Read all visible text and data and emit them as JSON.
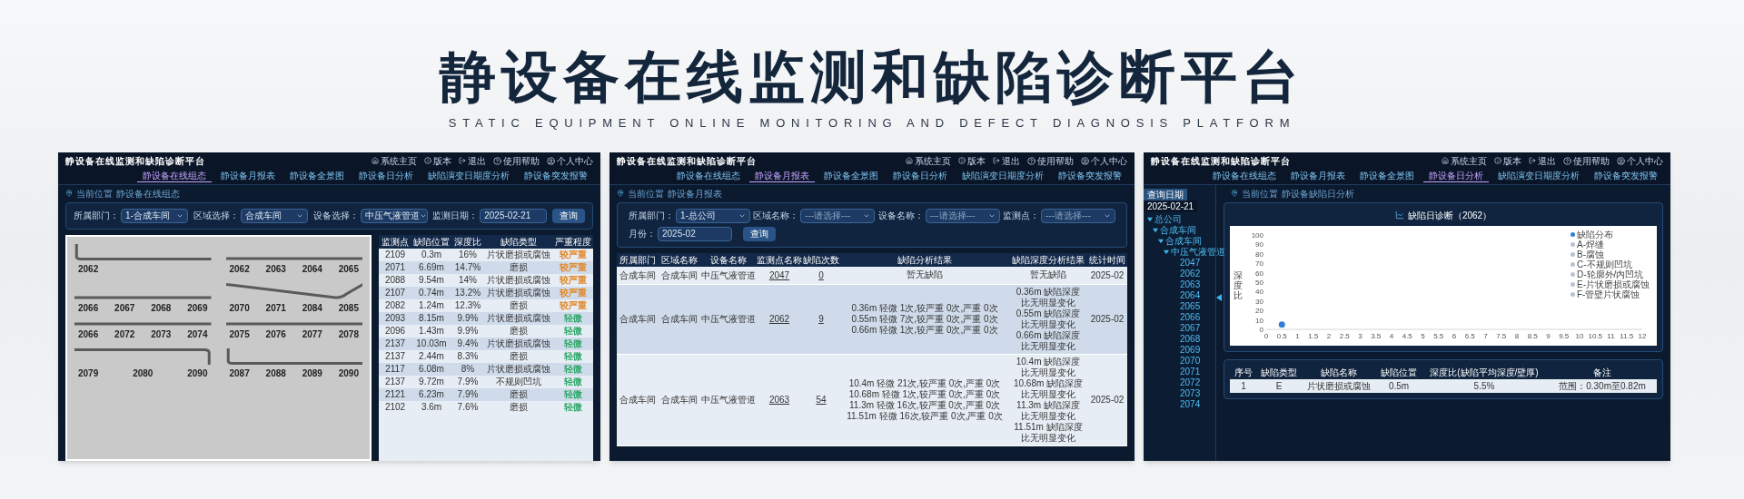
{
  "page": {
    "title": "静设备在线监测和缺陷诊断平台",
    "subtitle": "STATIC EQUIPMENT ONLINE MONITORING AND DEFECT DIAGNOSIS PLATFORM"
  },
  "screens": [
    {
      "kind": "layout",
      "header": {
        "title": "静设备在线监测和缺陷诊断平台",
        "top_links": [
          "系统主页",
          "版本",
          "退出"
        ],
        "help": "使用帮助",
        "user": "个人中心",
        "nav": [
          {
            "label": "静设备在线组态",
            "selected": true
          },
          {
            "label": "静设备月报表",
            "selected": false
          },
          {
            "label": "静设备全景图",
            "selected": false
          },
          {
            "label": "静设备日分析",
            "selected": false
          },
          {
            "label": "缺陷演变日期度分析",
            "selected": false
          },
          {
            "label": "静设备突发报警",
            "selected": false
          }
        ]
      },
      "breadcrumb": [
        "当前位置",
        "静设备在线组态"
      ],
      "filters": [
        {
          "label": "所属部门：",
          "value": "1-合成车间"
        },
        {
          "label": "区域选择：",
          "value": "合成车间"
        },
        {
          "label": "设备选择：",
          "value": "中压气液管道"
        },
        {
          "label": "监测日期：",
          "value": "2025-02-21",
          "kind": "date"
        }
      ],
      "query_button": "查询",
      "diagram": [
        {
          "kind": "elbow_start",
          "labels": [
            "2062"
          ]
        },
        {
          "kind": "straight",
          "labels": [
            "2062",
            "2063",
            "2064",
            "2065"
          ]
        },
        {
          "kind": "straight",
          "labels": [
            "2066",
            "2067",
            "2068",
            "2069"
          ]
        },
        {
          "kind": "slant",
          "labels": [
            "2070",
            "2071",
            "2084",
            "2085"
          ]
        },
        {
          "kind": "straight",
          "labels": [
            "2066",
            "2072",
            "2073",
            "2074"
          ]
        },
        {
          "kind": "straight",
          "labels": [
            "2075",
            "2076",
            "2077",
            "2078"
          ]
        },
        {
          "kind": "elbow_end",
          "labels": [
            "2079",
            "2080",
            "2090"
          ]
        },
        {
          "kind": "elbow_start",
          "labels": [
            "2087",
            "2088",
            "2089",
            "2090"
          ]
        }
      ],
      "table": {
        "columns": [
          "监测点",
          "缺陷位置",
          "深度比",
          "缺陷类型",
          "严重程度"
        ],
        "rows": [
          {
            "cells": [
              "2109",
              "0.3m",
              "16%",
              "片状磨损或腐蚀",
              "较严重"
            ],
            "color": "#e0892c"
          },
          {
            "cells": [
              "2071",
              "6.69m",
              "14.7%",
              "磨损",
              "较严重"
            ],
            "color": "#e0892c"
          },
          {
            "cells": [
              "2088",
              "9.54m",
              "14%",
              "片状磨损或腐蚀",
              "较严重"
            ],
            "color": "#e0892c"
          },
          {
            "cells": [
              "2107",
              "0.74m",
              "13.2%",
              "片状磨损或腐蚀",
              "较严重"
            ],
            "color": "#e0892c"
          },
          {
            "cells": [
              "2082",
              "1.24m",
              "12.3%",
              "磨损",
              "较严重"
            ],
            "color": "#e0892c"
          },
          {
            "cells": [
              "2093",
              "8.15m",
              "9.9%",
              "片状磨损或腐蚀",
              "轻微"
            ],
            "color": "#2fa86a"
          },
          {
            "cells": [
              "2096",
              "1.43m",
              "9.9%",
              "磨损",
              "轻微"
            ],
            "color": "#2fa86a"
          },
          {
            "cells": [
              "2137",
              "10.03m",
              "9.4%",
              "片状磨损或腐蚀",
              "轻微"
            ],
            "color": "#2fa86a"
          },
          {
            "cells": [
              "2137",
              "2.44m",
              "8.3%",
              "磨损",
              "轻微"
            ],
            "color": "#2fa86a"
          },
          {
            "cells": [
              "2117",
              "6.08m",
              "8%",
              "片状磨损或腐蚀",
              "轻微"
            ],
            "color": "#2fa86a"
          },
          {
            "cells": [
              "2137",
              "9.72m",
              "7.9%",
              "不规则凹坑",
              "轻微"
            ],
            "color": "#2fa86a"
          },
          {
            "cells": [
              "2121",
              "6.23m",
              "7.9%",
              "磨损",
              "轻微"
            ],
            "color": "#2fa86a"
          },
          {
            "cells": [
              "2102",
              "3.6m",
              "7.6%",
              "磨损",
              "轻微"
            ],
            "color": "#2fa86a"
          }
        ]
      }
    },
    {
      "kind": "report",
      "header": {
        "title": "静设备在线监测和缺陷诊断平台",
        "top_links": [
          "系统主页",
          "版本",
          "退出"
        ],
        "help": "使用帮助",
        "user": "个人中心",
        "nav": [
          {
            "label": "静设备在线组态",
            "selected": false
          },
          {
            "label": "静设备月报表",
            "selected": true
          },
          {
            "label": "静设备全景图",
            "selected": false
          },
          {
            "label": "静设备日分析",
            "selected": false
          },
          {
            "label": "缺陷演变日期度分析",
            "selected": false
          },
          {
            "label": "静设备突发报警",
            "selected": false
          }
        ]
      },
      "breadcrumb": [
        "当前位置",
        "静设备月报表"
      ],
      "filters": [
        {
          "label": "所属部门：",
          "value": "1-总公司"
        },
        {
          "label": "区域名称：",
          "placeholder": "---请选择---"
        },
        {
          "label": "设备名称：",
          "placeholder": "---请选择---"
        },
        {
          "label": "监测点：",
          "placeholder": "---请选择---"
        },
        {
          "label": "月份：",
          "value": "2025-02",
          "kind": "date"
        }
      ],
      "query_button": "查询",
      "table": {
        "columns": [
          "所属部门",
          "区域名称",
          "设备名称",
          "监测点名称",
          "缺陷次数",
          "缺陷分析结果",
          "缺陷深度分析结果",
          "统计时间"
        ],
        "rows": [
          {
            "department": "合成车间",
            "area": "合成车间",
            "device": "中压气液管道",
            "point": "2047",
            "defect_count": "0",
            "analysis": [
              "暂无缺陷"
            ],
            "depth_analysis": [
              "暂无缺陷"
            ],
            "month": "2025-02"
          },
          {
            "department": "合成车间",
            "area": "合成车间",
            "device": "中压气液管道",
            "point": "2062",
            "defect_count": "9",
            "analysis": [
              "0.36m 轻微 1次,较严重 0次,严重 0次",
              "0.55m 轻微 7次,较严重 0次,严重 0次",
              "0.66m 轻微 1次,较严重 0次,严重 0次"
            ],
            "depth_analysis": [
              "0.36m 缺陷深度比无明显变化",
              "0.55m 缺陷深度比无明显变化",
              "0.66m 缺陷深度比无明显变化"
            ],
            "month": "2025-02"
          },
          {
            "department": "合成车间",
            "area": "合成车间",
            "device": "中压气液管道",
            "point": "2063",
            "defect_count": "54",
            "analysis": [
              "10.4m 轻微 21次,较严重 0次,严重 0次",
              "10.68m 轻微 1次,较严重 0次,严重 0次",
              "11.3m 轻微 16次,较严重 0次,严重 0次",
              "11.51m 轻微 16次,较严重 0次,严重 0次"
            ],
            "depth_analysis": [
              "10.4m 缺陷深度比无明显变化",
              "10.68m 缺陷深度比无明显变化",
              "11.3m 缺陷深度比无明显变化",
              "11.51m 缺陷深度比无明显变化"
            ],
            "month": "2025-02"
          }
        ]
      }
    },
    {
      "kind": "daily",
      "header": {
        "title": "静设备在线监测和缺陷诊断平台",
        "top_links": [
          "系统主页",
          "版本",
          "退出"
        ],
        "help": "使用帮助",
        "user": "个人中心",
        "nav": [
          {
            "label": "静设备在线组态",
            "selected": false
          },
          {
            "label": "静设备月报表",
            "selected": false
          },
          {
            "label": "静设备全景图",
            "selected": false
          },
          {
            "label": "静设备日分析",
            "selected": true
          },
          {
            "label": "缺陷演变日期度分析",
            "selected": false
          },
          {
            "label": "静设备突发报警",
            "selected": false
          }
        ]
      },
      "breadcrumb": [
        "当前位置",
        "静设备缺陷日分析"
      ],
      "sidebar": {
        "date_label": "查询日期",
        "date": "2025-02-21",
        "tree": [
          {
            "label": "总公司",
            "expanded": true,
            "children": [
              {
                "label": "合成车间",
                "expanded": true,
                "children": [
                  {
                    "label": "合成车间",
                    "expanded": true,
                    "children": [
                      {
                        "label": "中压气液管道",
                        "expanded": true,
                        "children": [
                          {
                            "label": "2047"
                          },
                          {
                            "label": "2062"
                          },
                          {
                            "label": "2063"
                          },
                          {
                            "label": "2064"
                          },
                          {
                            "label": "2065"
                          },
                          {
                            "label": "2066"
                          },
                          {
                            "label": "2067"
                          },
                          {
                            "label": "2068"
                          },
                          {
                            "label": "2069"
                          },
                          {
                            "label": "2070"
                          },
                          {
                            "label": "2071"
                          },
                          {
                            "label": "2072"
                          },
                          {
                            "label": "2073"
                          },
                          {
                            "label": "2074"
                          }
                        ]
                      }
                    ]
                  }
                ]
              }
            ]
          }
        ]
      },
      "chart_title": "缺陷日诊断（2062）",
      "chart_data": {
        "type": "scatter",
        "ylabel": "深度比",
        "x": [
          0.5
        ],
        "series": [
          {
            "name": "缺陷分布",
            "color": "#2f7fd8",
            "values": [
              5
            ]
          },
          {
            "name": "A-焊缝",
            "color": "#b7c4d4",
            "values": [
              null
            ]
          },
          {
            "name": "B-腐蚀",
            "color": "#b7c4d4",
            "values": [
              null
            ]
          },
          {
            "name": "C-不规则凹坑",
            "color": "#b7c4d4",
            "values": [
              null
            ]
          },
          {
            "name": "D-轮廓外/内凹坑",
            "color": "#b7c4d4",
            "values": [
              null
            ]
          },
          {
            "name": "E-片状磨损或腐蚀",
            "color": "#b7c4d4",
            "values": [
              null
            ]
          },
          {
            "name": "F-管壁片状腐蚀",
            "color": "#b7c4d4",
            "values": [
              null
            ]
          }
        ],
        "xlim": [
          0,
          12
        ],
        "ylim": [
          0,
          100
        ],
        "xticks": [
          0,
          0.5,
          1,
          1.5,
          2,
          2.5,
          3,
          3.5,
          4,
          4.5,
          5,
          5.5,
          6,
          6.5,
          7,
          7.5,
          8,
          8.5,
          9,
          9.5,
          10,
          10.5,
          11,
          11.5,
          12
        ],
        "yticks": [
          0,
          10,
          20,
          30,
          40,
          50,
          60,
          70,
          80,
          90,
          100
        ]
      },
      "table": {
        "columns": [
          "序号",
          "缺陷类型",
          "缺陷名称",
          "缺陷位置",
          "深度比(缺陷平均深度/壁厚)",
          "备注"
        ],
        "rows": [
          [
            "1",
            "E",
            "片状磨损或腐蚀",
            "0.5m",
            "5.5%",
            "范围：0.30m至0.82m"
          ]
        ]
      }
    }
  ]
}
